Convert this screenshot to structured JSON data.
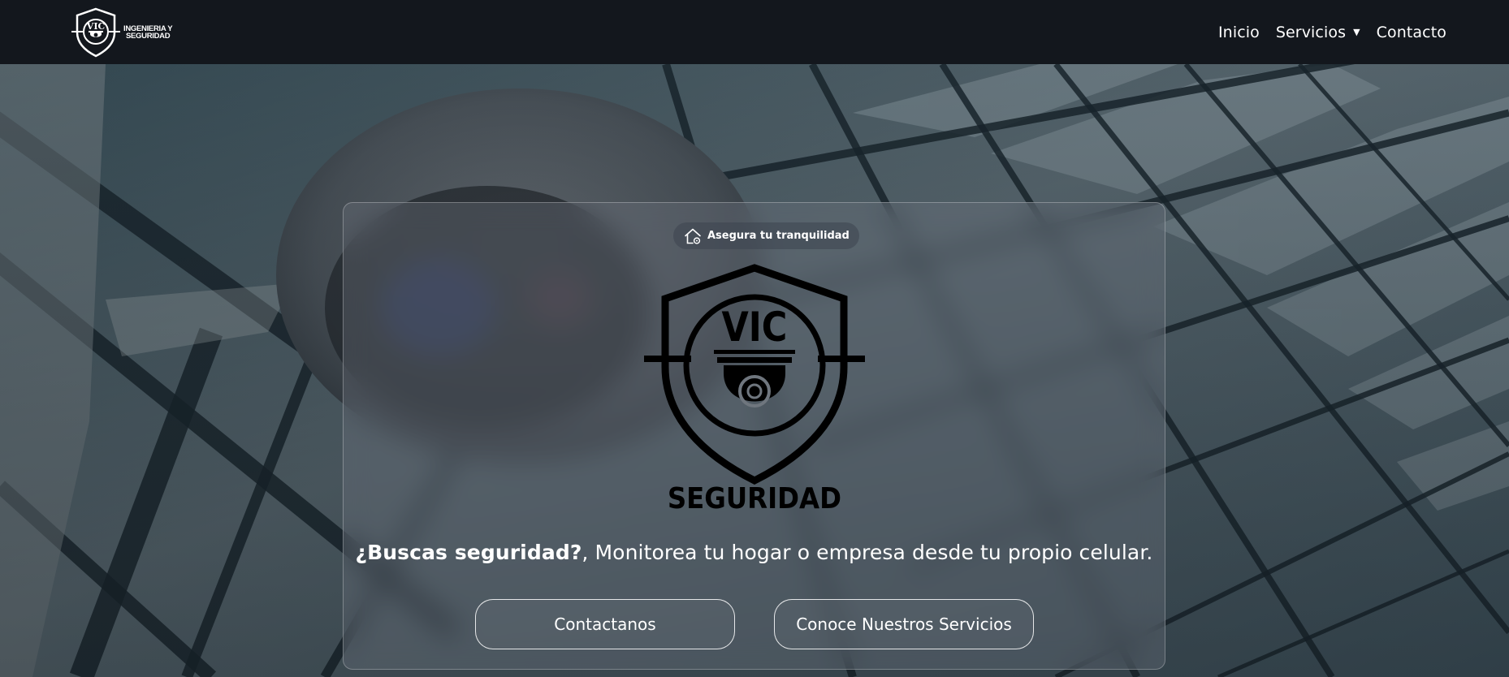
{
  "header": {
    "brand_line1": "INGENIERIA Y",
    "brand_line2": "SEGURIDAD",
    "logo_text": "VIC",
    "nav": [
      {
        "label": "Inicio"
      },
      {
        "label": "Servicios",
        "has_dropdown": true
      },
      {
        "label": "Contacto"
      }
    ]
  },
  "hero": {
    "badge_icon": "home-lock-icon",
    "badge_label": "Asegura tu tranquilidad",
    "logo_text_top": "VIC",
    "logo_text_bottom": "SEGURIDAD",
    "tagline_bold": "¿Buscas seguridad?",
    "tagline_rest": ", Monitorea tu hogar o empresa desde tu propio celular.",
    "primary_button": "Contactanos",
    "secondary_button": "Conoce Nuestros Servicios"
  },
  "colors": {
    "header_bg": "#13171d",
    "text": "#ffffff",
    "logo": "#000000"
  }
}
